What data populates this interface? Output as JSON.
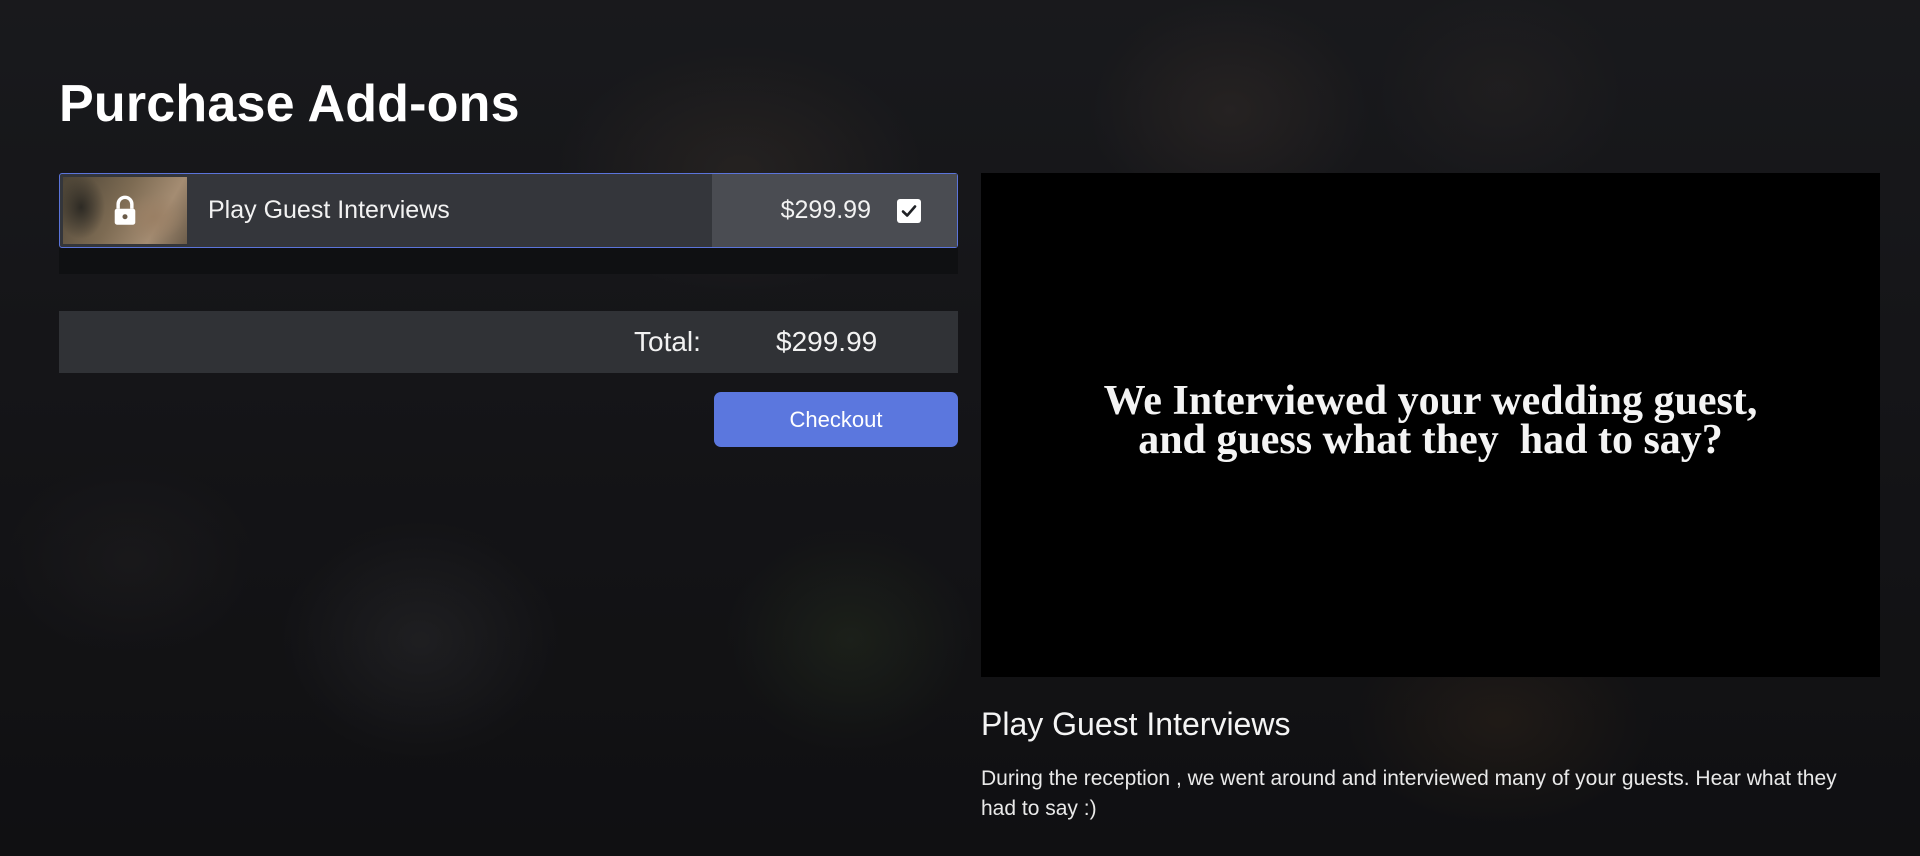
{
  "page": {
    "title": "Purchase Add-ons"
  },
  "addons": [
    {
      "name": "Play Guest Interviews",
      "price": "$299.99",
      "selected": true,
      "locked": true,
      "lock_icon": "lock-icon",
      "check_icon": "check-icon"
    }
  ],
  "cart": {
    "total_label": "Total:",
    "total_value": "$299.99",
    "checkout_label": "Checkout"
  },
  "preview": {
    "caption_line1": "We Interviewed your wedding guest,",
    "caption_line2": "and guess what they  had to say?",
    "title": "Play Guest Interviews",
    "description": "During the reception , we went around and interviewed many of your guests. Hear what they had to say :)"
  },
  "colors": {
    "accent": "#5b77de",
    "selected_border": "#5b74da",
    "row_bg": "#34363b",
    "price_cell_bg": "#4a4c52",
    "video_bg": "#000000"
  }
}
